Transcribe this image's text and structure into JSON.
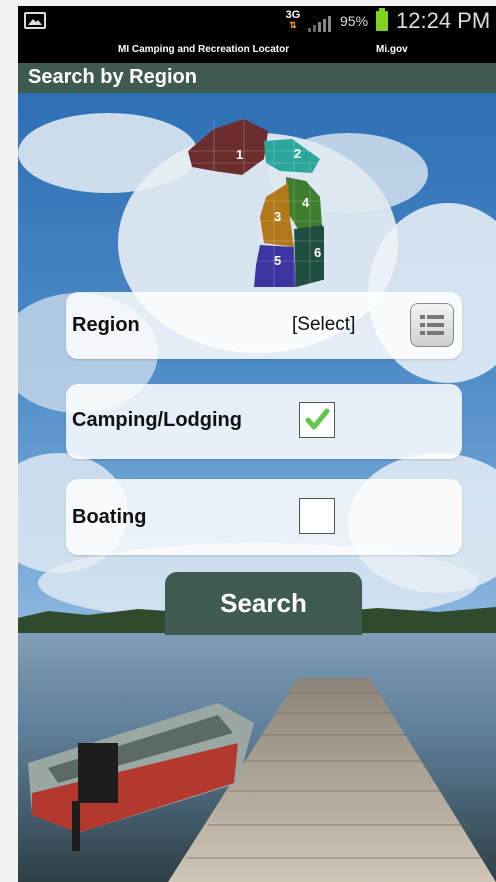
{
  "status_bar": {
    "network": "3G",
    "battery_percent": "95%",
    "time": "12:24 PM"
  },
  "title_strip": {
    "app_title": "MI Camping and Recreation Locator",
    "site_link": "Mi.gov"
  },
  "header": {
    "title": "Search by Region"
  },
  "map": {
    "regions": [
      {
        "label": "1",
        "color": "#6b2d2d"
      },
      {
        "label": "2",
        "color": "#2aa69a"
      },
      {
        "label": "3",
        "color": "#b07818"
      },
      {
        "label": "4",
        "color": "#3f7d2e"
      },
      {
        "label": "5",
        "color": "#3a35a0"
      },
      {
        "label": "6",
        "color": "#1f4d3f"
      }
    ]
  },
  "form": {
    "region_label": "Region",
    "region_value": "[Select]",
    "camping_label": "Camping/Lodging",
    "camping_checked": true,
    "boating_label": "Boating",
    "boating_checked": false,
    "search_label": "Search"
  },
  "colors": {
    "header_bg": "#3f5a51",
    "check_green": "#63c64a",
    "battery_green": "#7ed321"
  }
}
